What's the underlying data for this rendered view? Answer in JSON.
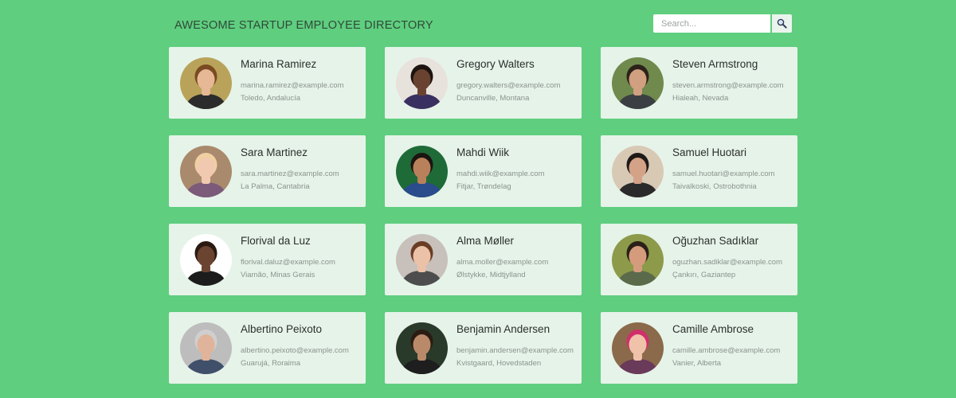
{
  "header": {
    "title": "AWESOME STARTUP EMPLOYEE DIRECTORY",
    "search_placeholder": "Search...",
    "search_button_icon": "magnifier-icon"
  },
  "colors": {
    "background": "#5fce7f",
    "card": "#e6f3e9",
    "accent": "#2f6fd1"
  },
  "employees": [
    {
      "name": "Marina Ramirez",
      "email": "marina.ramirez@example.com",
      "location": "Toledo, Andalucía",
      "avatar": {
        "bg": "#b9a35a",
        "skin": "#e6b896",
        "hair": "#7a4a22",
        "shirt": "#2c2c2c"
      }
    },
    {
      "name": "Gregory Walters",
      "email": "gregory.walters@example.com",
      "location": "Duncanville, Montana",
      "avatar": {
        "bg": "#e8e2dc",
        "skin": "#6a4330",
        "hair": "#1b1410",
        "shirt": "#3a3060"
      }
    },
    {
      "name": "Steven Armstrong",
      "email": "steven.armstrong@example.com",
      "location": "Hialeah, Nevada",
      "avatar": {
        "bg": "#6f8a4c",
        "skin": "#d1a080",
        "hair": "#2c221a",
        "shirt": "#3b3f44"
      }
    },
    {
      "name": "Sara Martinez",
      "email": "sara.martinez@example.com",
      "location": "La Palma, Cantabria",
      "avatar": {
        "bg": "#a98a6c",
        "skin": "#f1c9b0",
        "hair": "#f0cfa2",
        "shirt": "#7b5a7a"
      }
    },
    {
      "name": "Mahdi Wiik",
      "email": "mahdi.wiik@example.com",
      "location": "Fitjar, Trøndelag",
      "avatar": {
        "bg": "#1f6b38",
        "skin": "#b9805c",
        "hair": "#1c1410",
        "shirt": "#2a4b8c"
      }
    },
    {
      "name": "Samuel Huotari",
      "email": "samuel.huotari@example.com",
      "location": "Taivalkoski, Ostrobothnia",
      "avatar": {
        "bg": "#d8c9b5",
        "skin": "#d4a287",
        "hair": "#1e1a18",
        "shirt": "#2a2a2a"
      }
    },
    {
      "name": "Florival da Luz",
      "email": "florival.daluz@example.com",
      "location": "Viamão, Minas Gerais",
      "avatar": {
        "bg": "#ffffff",
        "skin": "#6a4430",
        "hair": "#2a1a12",
        "shirt": "#1c1c1c"
      }
    },
    {
      "name": "Alma Møller",
      "email": "alma.moller@example.com",
      "location": "Ølstykke, Midtjylland",
      "avatar": {
        "bg": "#c8c0bb",
        "skin": "#ebc1a8",
        "hair": "#6a3c24",
        "shirt": "#4d4d4d"
      }
    },
    {
      "name": "Oğuzhan Sadıklar",
      "email": "oguzhan.sadiklar@example.com",
      "location": "Çankırı, Gaziantep",
      "avatar": {
        "bg": "#8c9a4a",
        "skin": "#d49c7c",
        "hair": "#2a2018",
        "shirt": "#5a6a4a"
      }
    },
    {
      "name": "Albertino Peixoto",
      "email": "albertino.peixoto@example.com",
      "location": "Guarujá, Roraima",
      "avatar": {
        "bg": "#bdbdbd",
        "skin": "#e0b49a",
        "hair": "#cfcfcf",
        "shirt": "#40506a"
      }
    },
    {
      "name": "Benjamin Andersen",
      "email": "benjamin.andersen@example.com",
      "location": "Kvistgaard, Hovedstaden",
      "avatar": {
        "bg": "#2a3a2a",
        "skin": "#b98a6a",
        "hair": "#2a1c12",
        "shirt": "#1e1e1e"
      }
    },
    {
      "name": "Camille Ambrose",
      "email": "camille.ambrose@example.com",
      "location": "Vanier, Alberta",
      "avatar": {
        "bg": "#8a6a4a",
        "skin": "#f0c2aa",
        "hair": "#d0306a",
        "shirt": "#6a3a5a"
      }
    }
  ]
}
